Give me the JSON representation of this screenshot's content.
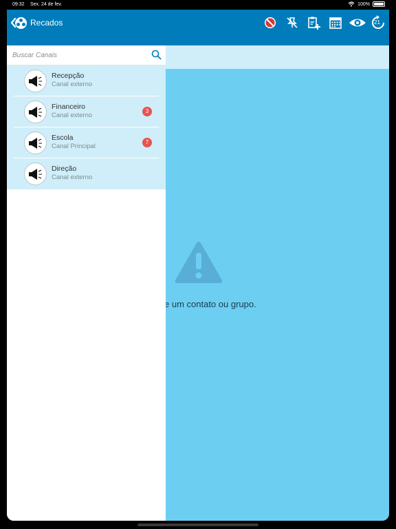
{
  "status_bar": {
    "time": "09:32",
    "date": "Sex. 24 de fev.",
    "battery": "100%"
  },
  "navbar": {
    "title": "Recados",
    "icons": [
      "back-chevron-icon",
      "app-logo-icon",
      "no-entry-icon",
      "no-pin-icon",
      "add-assignment-icon",
      "calendar-icon",
      "eye-icon",
      "refresh-counter-icon"
    ],
    "refresh_count": "21"
  },
  "search": {
    "placeholder": "Buscar Canais"
  },
  "channels": [
    {
      "name": "Recepção",
      "subtitle": "Canal externo",
      "badge": ""
    },
    {
      "name": "Financeiro",
      "subtitle": "Canal externo",
      "badge": "3"
    },
    {
      "name": "Escola",
      "subtitle": "Canal Principal",
      "badge": "7"
    },
    {
      "name": "Direção",
      "subtitle": "Canal externo",
      "badge": ""
    }
  ],
  "empty_state": {
    "message": "e um contato ou grupo."
  },
  "colors": {
    "navbar": "#007cba",
    "content_bg": "#6ccff2",
    "selected_row": "#cfeef9",
    "badge": "#e85350"
  }
}
